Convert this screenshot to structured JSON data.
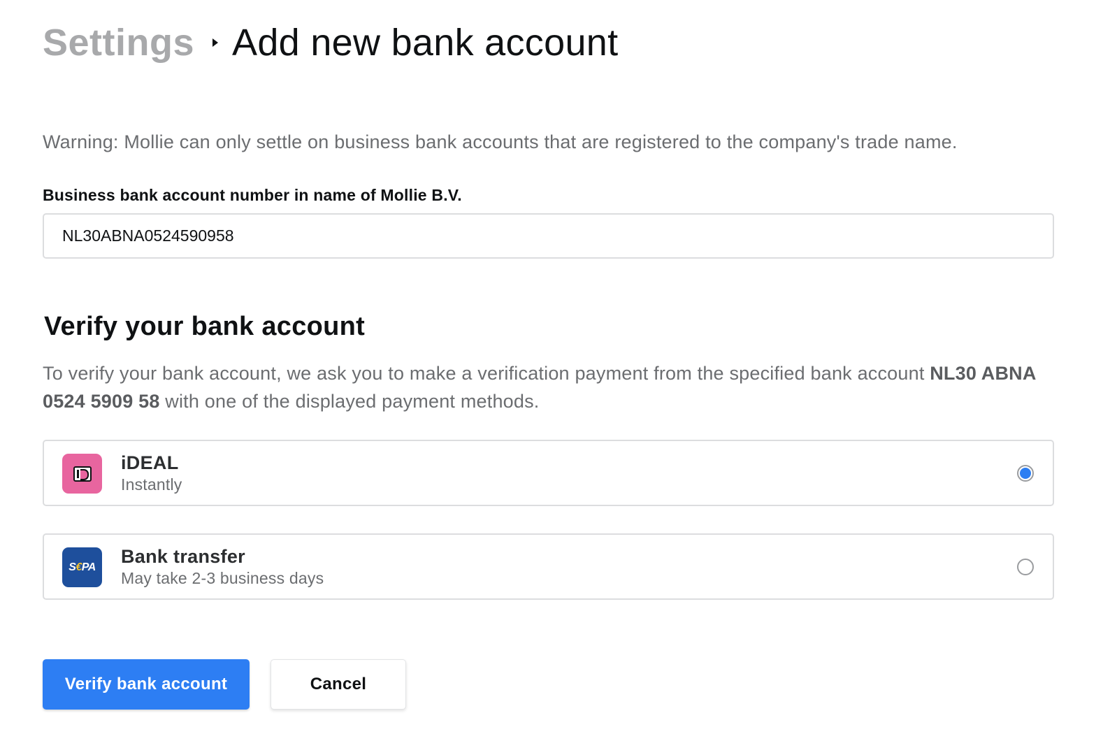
{
  "breadcrumb": {
    "parent": "Settings",
    "current": "Add new bank account",
    "separator_icon": "caret-right-icon"
  },
  "warning": "Warning: Mollie can only settle on business bank accounts that are registered to the company's trade name.",
  "account_field": {
    "label": "Business bank account number in name of Mollie B.V.",
    "value": "NL30ABNA0524590958"
  },
  "verify_section": {
    "title": "Verify your bank account",
    "desc_before": "To verify your bank account, we ask you to make a verification payment from the specified bank account ",
    "desc_account": "NL30 ABNA 0524 5909 58",
    "desc_after": " with one of the displayed payment methods."
  },
  "payment_methods": [
    {
      "title": "iDEAL",
      "subtitle": "Instantly",
      "icon": "ideal-logo-icon",
      "logo_color": "#e8659f",
      "selected": true
    },
    {
      "title": "Bank transfer",
      "subtitle": "May take 2-3 business days",
      "icon": "sepa-logo-icon",
      "logo_text_s": "S",
      "logo_text_euro": "€",
      "logo_text_pa": "PA",
      "logo_color": "#1e4f9c",
      "selected": false
    }
  ],
  "actions": {
    "primary": "Verify bank account",
    "secondary": "Cancel"
  },
  "colors": {
    "primary": "#2d7ef3",
    "muted_text": "#6b6d70",
    "breadcrumb_parent": "#a8a9ab"
  }
}
